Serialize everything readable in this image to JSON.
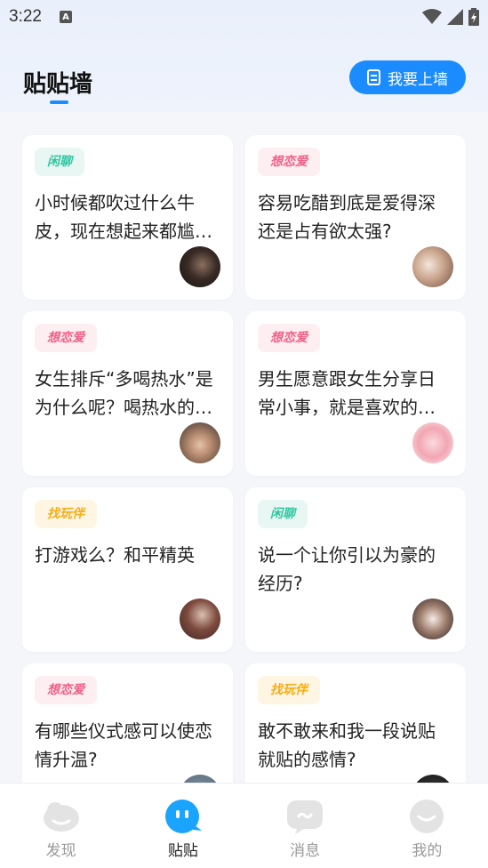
{
  "status_bar": {
    "time": "3:22",
    "a_badge": "A"
  },
  "header": {
    "title": "贴贴墙",
    "post_button_label": "我要上墙"
  },
  "cards": [
    {
      "tag": "闲聊",
      "tag_type": "xianliao",
      "text": "小时候都吹过什么牛皮，现在想起来都尴尬死了",
      "avatar": "av1"
    },
    {
      "tag": "想恋爱",
      "tag_type": "xianglianai",
      "text": "容易吃醋到底是爱得深还是占有欲太强?",
      "avatar": "av2"
    },
    {
      "tag": "想恋爱",
      "tag_type": "xianglianai",
      "text": "女生排斥“多喝热水”是为什么呢？喝热水的好处",
      "avatar": "av3"
    },
    {
      "tag": "想恋爱",
      "tag_type": "xianglianai",
      "text": "男生愿意跟女生分享日常小事，就是喜欢的表现吗",
      "avatar": "av4"
    },
    {
      "tag": "找玩伴",
      "tag_type": "zhaowanban",
      "text": "打游戏么？和平精英",
      "avatar": "av5"
    },
    {
      "tag": "闲聊",
      "tag_type": "xianliao",
      "text": "说一个让你引以为豪的经历?",
      "avatar": "av6"
    },
    {
      "tag": "想恋爱",
      "tag_type": "xianglianai",
      "text": "有哪些仪式感可以使恋情升温?",
      "avatar": "av7"
    },
    {
      "tag": "找玩伴",
      "tag_type": "zhaowanban",
      "text": "敢不敢来和我一段说贴就贴的感情?",
      "avatar": "av8"
    }
  ],
  "bottom_nav": {
    "items": [
      {
        "label": "发现",
        "icon": "cloud-icon",
        "active": false
      },
      {
        "label": "贴贴",
        "icon": "smile-bubble-icon",
        "active": true
      },
      {
        "label": "消息",
        "icon": "chat-icon",
        "active": false
      },
      {
        "label": "我的",
        "icon": "profile-icon",
        "active": false
      }
    ]
  },
  "colors": {
    "accent": "#1a8cff",
    "tag_xianliao": "#31c7a2",
    "tag_xianglianai": "#f25f86",
    "tag_zhaowanban": "#f8ad14"
  }
}
